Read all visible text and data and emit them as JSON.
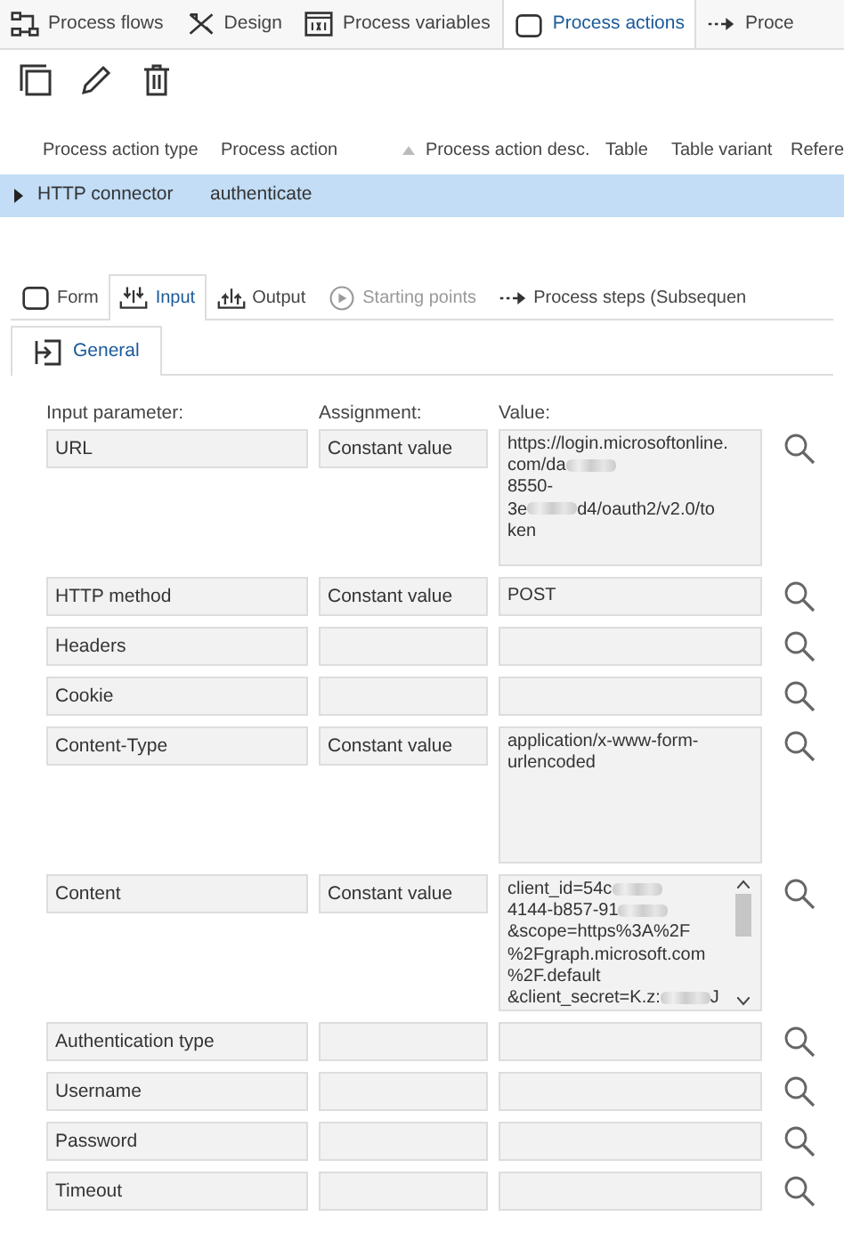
{
  "top_tabs": [
    {
      "label": "Process flows",
      "selected": false
    },
    {
      "label": "Design",
      "selected": false
    },
    {
      "label": "Process variables",
      "selected": false
    },
    {
      "label": "Process actions",
      "selected": true
    },
    {
      "label": "Proce",
      "selected": false
    }
  ],
  "grid": {
    "columns": [
      {
        "label": "Process action type",
        "sorted": false
      },
      {
        "label": "Process action",
        "sorted": false
      },
      {
        "label": "Process action desc.",
        "sorted": true
      },
      {
        "label": "Table",
        "sorted": false
      },
      {
        "label": "Table variant",
        "sorted": false
      },
      {
        "label": "Refere",
        "sorted": false
      }
    ],
    "rows": [
      {
        "selected": true,
        "cells": [
          "HTTP connector",
          "authenticate"
        ]
      }
    ]
  },
  "sub_tabs": [
    {
      "label": "Form",
      "selected": false,
      "disabled": false
    },
    {
      "label": "Input",
      "selected": true,
      "disabled": false
    },
    {
      "label": "Output",
      "selected": false,
      "disabled": false
    },
    {
      "label": "Starting points",
      "selected": false,
      "disabled": true
    },
    {
      "label": "Process steps (Subsequen",
      "selected": false,
      "disabled": false
    }
  ],
  "section_tabs": [
    {
      "label": "General",
      "selected": true
    }
  ],
  "headers": [
    "Input parameter:",
    "Assignment:",
    "Value:"
  ],
  "parameters": [
    {
      "name": "URL",
      "assignment": "Constant value",
      "scroll": false,
      "value": [
        [
          {
            "kind": "text",
            "text": "https://login.microsoftonline."
          }
        ],
        [
          {
            "kind": "text",
            "text": "com/da"
          },
          {
            "kind": "redacted"
          }
        ],
        [
          {
            "kind": "text",
            "text": "8550-"
          }
        ],
        [
          {
            "kind": "text",
            "text": "3e"
          },
          {
            "kind": "redacted"
          },
          {
            "kind": "text",
            "text": "d4/oauth2/v2.0/to"
          }
        ],
        [
          {
            "kind": "text",
            "text": "ken"
          }
        ]
      ]
    },
    {
      "name": "HTTP method",
      "assignment": "Constant value",
      "scroll": false,
      "value": [
        [
          {
            "kind": "text",
            "text": "POST"
          }
        ]
      ]
    },
    {
      "name": "Headers",
      "scroll": false
    },
    {
      "name": "Cookie",
      "scroll": false
    },
    {
      "name": "Content-Type",
      "assignment": "Constant value",
      "scroll": false,
      "value": [
        [
          {
            "kind": "text",
            "text": "application/x-www-form-"
          }
        ],
        [
          {
            "kind": "text",
            "text": "urlencoded"
          }
        ]
      ]
    },
    {
      "name": "Content",
      "assignment": "Constant value",
      "scroll": true,
      "value": [
        [
          {
            "kind": "text",
            "text": "client_id=54c"
          },
          {
            "kind": "redacted"
          }
        ],
        [
          {
            "kind": "text",
            "text": "4144-b857-91"
          },
          {
            "kind": "redacted"
          }
        ],
        [
          {
            "kind": "text",
            "text": "&scope=https%3A%2F"
          }
        ],
        [
          {
            "kind": "text",
            "text": "%2Fgraph.microsoft.com"
          }
        ],
        [
          {
            "kind": "text",
            "text": "%2F.default"
          }
        ],
        [
          {
            "kind": "text",
            "text": "&client_secret=K.z:"
          },
          {
            "kind": "redacted"
          },
          {
            "kind": "text",
            "text": "J"
          }
        ]
      ]
    },
    {
      "name": "Authentication type",
      "scroll": false
    },
    {
      "name": "Username",
      "scroll": false
    },
    {
      "name": "Password",
      "scroll": false
    },
    {
      "name": "Timeout",
      "scroll": false
    }
  ]
}
